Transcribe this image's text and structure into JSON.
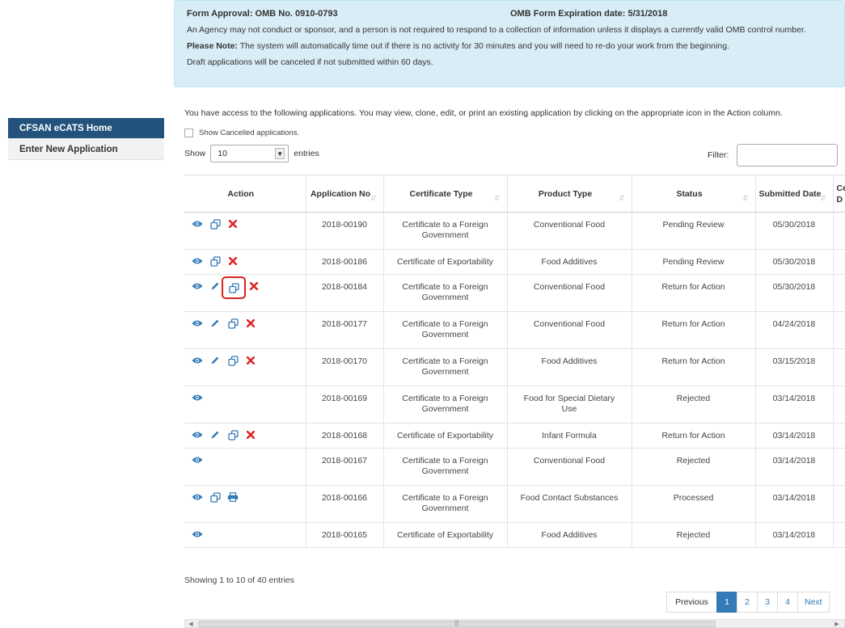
{
  "notice": {
    "approval": "Form Approval: OMB No. 0910-0793",
    "expiration": "OMB Form Expiration date: 5/31/2018",
    "line1": "An Agency may not conduct or sponsor, and a person is not required to respond to a collection of information unless it displays a currently valid OMB control number.",
    "note_label": "Please Note:",
    "note_text": " The system will automatically time out if there is no activity for 30 minutes and you will need to re-do your work from the beginning.",
    "line3": "Draft applications will be canceled if not submitted within 60 days."
  },
  "sidebar": {
    "items": [
      {
        "label": "CFSAN eCATS Home"
      },
      {
        "label": "Enter New Application"
      }
    ]
  },
  "intro": "You have access to the following applications. You may view, clone, edit, or print an existing application by clicking on the appropriate icon in the Action column.",
  "show_cancelled": "Show Cancelled applications.",
  "length": {
    "show": "Show",
    "value": "10",
    "entries": "entries"
  },
  "filter": {
    "label": "Filter:"
  },
  "table": {
    "headers": [
      "Action",
      "Application No",
      "Certificate Type",
      "Product Type",
      "Status",
      "Submitted Date",
      "Ce D"
    ],
    "rows": [
      {
        "app_no": "2018-00190",
        "cert": "Certificate to a Foreign Government",
        "product": "Conventional Food",
        "status": "Pending Review",
        "date": "05/30/2018",
        "actions": [
          "view",
          "clone",
          "delete"
        ]
      },
      {
        "app_no": "2018-00186",
        "cert": "Certificate of Exportability",
        "product": "Food Additives",
        "status": "Pending Review",
        "date": "05/30/2018",
        "actions": [
          "view",
          "clone",
          "delete"
        ]
      },
      {
        "app_no": "2018-00184",
        "cert": "Certificate to a Foreign Government",
        "product": "Conventional Food",
        "status": "Return for Action",
        "date": "05/30/2018",
        "actions": [
          "view",
          "edit",
          "clone-highlighted",
          "delete"
        ]
      },
      {
        "app_no": "2018-00177",
        "cert": "Certificate to a Foreign Government",
        "product": "Conventional Food",
        "status": "Return for Action",
        "date": "04/24/2018",
        "actions": [
          "view",
          "edit",
          "clone",
          "delete"
        ]
      },
      {
        "app_no": "2018-00170",
        "cert": "Certificate to a Foreign Government",
        "product": "Food Additives",
        "status": "Return for Action",
        "date": "03/15/2018",
        "actions": [
          "view",
          "edit",
          "clone",
          "delete"
        ]
      },
      {
        "app_no": "2018-00169",
        "cert": "Certificate to a Foreign Government",
        "product": "Food for Special Dietary Use",
        "status": "Rejected",
        "date": "03/14/2018",
        "actions": [
          "view"
        ]
      },
      {
        "app_no": "2018-00168",
        "cert": "Certificate of Exportability",
        "product": "Infant Formula",
        "status": "Return for Action",
        "date": "03/14/2018",
        "actions": [
          "view",
          "edit",
          "clone",
          "delete"
        ]
      },
      {
        "app_no": "2018-00167",
        "cert": "Certificate to a Foreign Government",
        "product": "Conventional Food",
        "status": "Rejected",
        "date": "03/14/2018",
        "actions": [
          "view"
        ]
      },
      {
        "app_no": "2018-00166",
        "cert": "Certificate to a Foreign Government",
        "product": "Food Contact Substances",
        "status": "Processed",
        "date": "03/14/2018",
        "actions": [
          "view",
          "clone",
          "print"
        ]
      },
      {
        "app_no": "2018-00165",
        "cert": "Certificate of Exportability",
        "product": "Food Additives",
        "status": "Rejected",
        "date": "03/14/2018",
        "actions": [
          "view"
        ]
      }
    ]
  },
  "showing": "Showing 1 to 10 of 40 entries",
  "pager": {
    "previous": "Previous",
    "pages": [
      "1",
      "2",
      "3",
      "4"
    ],
    "next": "Next",
    "current": "1"
  },
  "colors": {
    "accent": "#337ab7",
    "sidebar_active": "#23527c",
    "notice_bg": "#d9edf7",
    "delete": "#e02020",
    "highlight": "#d9241a"
  },
  "icons": {
    "view": "eye-icon",
    "edit": "pencil-icon",
    "clone": "clone-icon",
    "delete": "delete-x-icon",
    "print": "print-icon"
  }
}
